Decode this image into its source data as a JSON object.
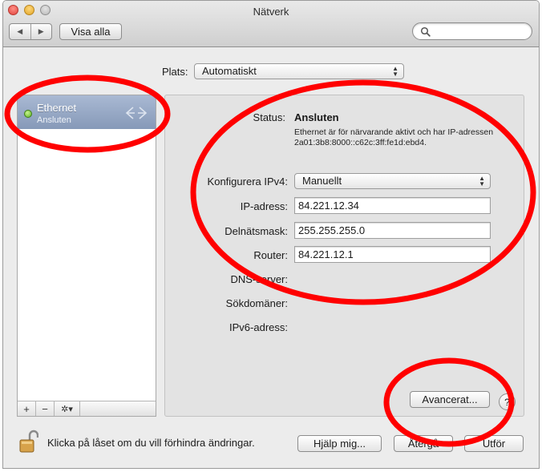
{
  "window": {
    "title": "Nätverk"
  },
  "toolbar": {
    "back_glyph": "◀",
    "forward_glyph": "▶",
    "show_all_label": "Visa alla",
    "search_placeholder": ""
  },
  "location": {
    "label": "Plats:",
    "value": "Automatiskt"
  },
  "services": [
    {
      "name": "Ethernet",
      "status": "Ansluten",
      "status_color": "#5cb023"
    }
  ],
  "sidebar_tools": {
    "add": "+",
    "remove": "−",
    "action": "✲▾"
  },
  "details": {
    "status_label": "Status:",
    "status_value": "Ansluten",
    "status_description": "Ethernet är för närvarande aktivt och har IP-adressen 2a01:3b8:8000::c62c:3ff:fe1d:ebd4.",
    "configure_label": "Konfigurera IPv4:",
    "configure_value": "Manuellt",
    "ip_label": "IP-adress:",
    "ip_value": "84.221.12.34",
    "subnet_label": "Delnätsmask:",
    "subnet_value": "255.255.255.0",
    "router_label": "Router:",
    "router_value": "84.221.12.1",
    "dns_label": "DNS-server:",
    "search_domains_label": "Sökdomäner:",
    "ipv6_label": "IPv6-adress:",
    "advanced_label": "Avancerat...",
    "help_glyph": "?"
  },
  "footer": {
    "lock_text": "Klicka på låset om du vill förhindra ändringar.",
    "assist_label": "Hjälp mig...",
    "revert_label": "Återgå",
    "apply_label": "Utför"
  },
  "annotation_color": "#ff0000"
}
